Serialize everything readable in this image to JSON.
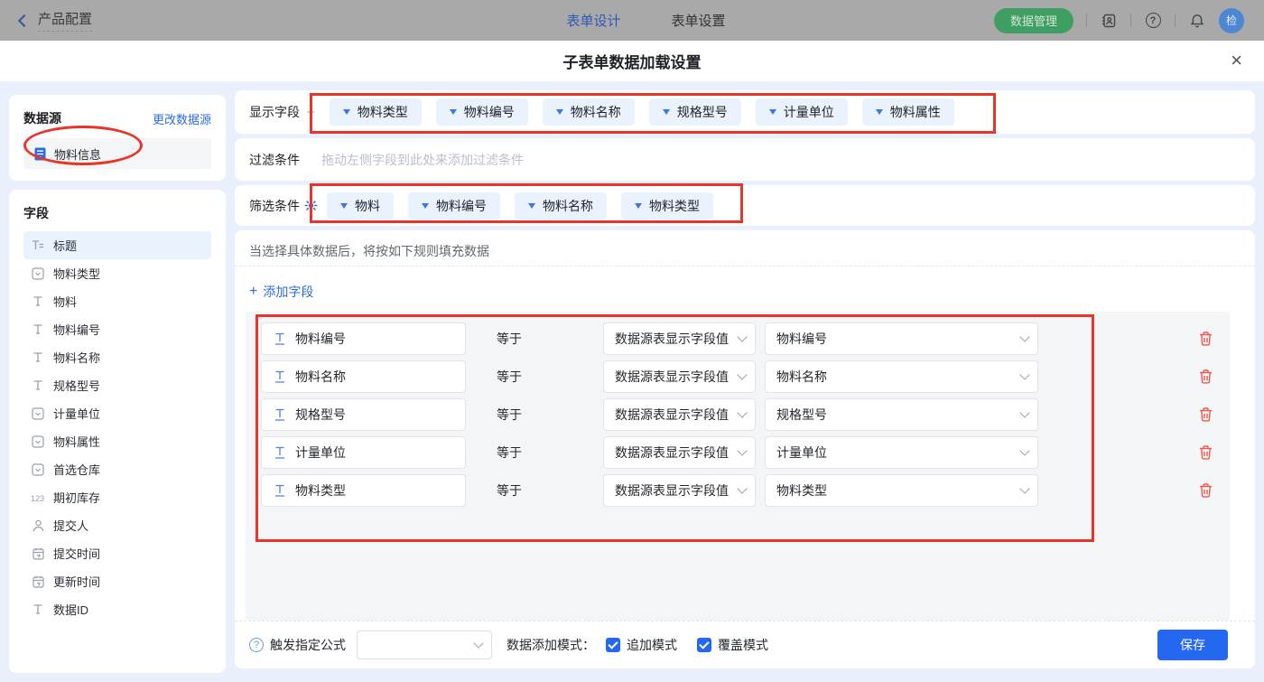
{
  "colors": {
    "accent": "#2e6be6",
    "save_button": "#2468f2",
    "annotation_red": "#e8352a",
    "data_manage_green": "#3f9e62",
    "tag_bg": "#e9f2fd"
  },
  "header": {
    "back_label": "产品配置",
    "tabs": [
      {
        "label": "表单设计",
        "active": true
      },
      {
        "label": "表单设置",
        "active": false
      }
    ],
    "data_manage_button": "数据管理",
    "avatar_text": "检"
  },
  "dialog": {
    "title": "子表单数据加载设置",
    "close": "×"
  },
  "sidebar": {
    "datasource_title": "数据源",
    "change_link": "更改数据源",
    "datasource_item": "物料信息",
    "fields_title": "字段",
    "fields": [
      {
        "label": "标题",
        "type": "title",
        "selected": true
      },
      {
        "label": "物料类型",
        "type": "select"
      },
      {
        "label": "物料",
        "type": "text"
      },
      {
        "label": "物料编号",
        "type": "text"
      },
      {
        "label": "物料名称",
        "type": "text"
      },
      {
        "label": "规格型号",
        "type": "text"
      },
      {
        "label": "计量单位",
        "type": "select"
      },
      {
        "label": "物料属性",
        "type": "select"
      },
      {
        "label": "首选仓库",
        "type": "select"
      },
      {
        "label": "期初库存",
        "type": "number"
      },
      {
        "label": "提交人",
        "type": "person"
      },
      {
        "label": "提交时间",
        "type": "date"
      },
      {
        "label": "更新时间",
        "type": "date"
      },
      {
        "label": "数据ID",
        "type": "text"
      }
    ]
  },
  "main": {
    "display_fields": {
      "label": "显示字段",
      "tags": [
        "物料类型",
        "物料编号",
        "物料名称",
        "规格型号",
        "计量单位",
        "物料属性"
      ]
    },
    "filter": {
      "label": "过滤条件",
      "placeholder": "拖动左侧字段到此处来添加过滤条件"
    },
    "screen_filter": {
      "label": "筛选条件",
      "tags": [
        "物料",
        "物料编号",
        "物料名称",
        "物料类型"
      ]
    },
    "rules_hint": "当选择具体数据后，将按如下规则填充数据",
    "add_field_label": "添加字段",
    "equals_label": "等于",
    "source_select_value": "数据源表显示字段值",
    "rules": [
      {
        "field": "物料编号",
        "target": "物料编号"
      },
      {
        "field": "物料名称",
        "target": "物料名称"
      },
      {
        "field": "规格型号",
        "target": "规格型号"
      },
      {
        "field": "计量单位",
        "target": "计量单位"
      },
      {
        "field": "物料类型",
        "target": "物料类型"
      }
    ]
  },
  "footer": {
    "formula_label": "触发指定公式",
    "mode_label": "数据添加模式：",
    "append_mode": "追加模式",
    "overwrite_mode": "覆盖模式",
    "save_button": "保存"
  }
}
